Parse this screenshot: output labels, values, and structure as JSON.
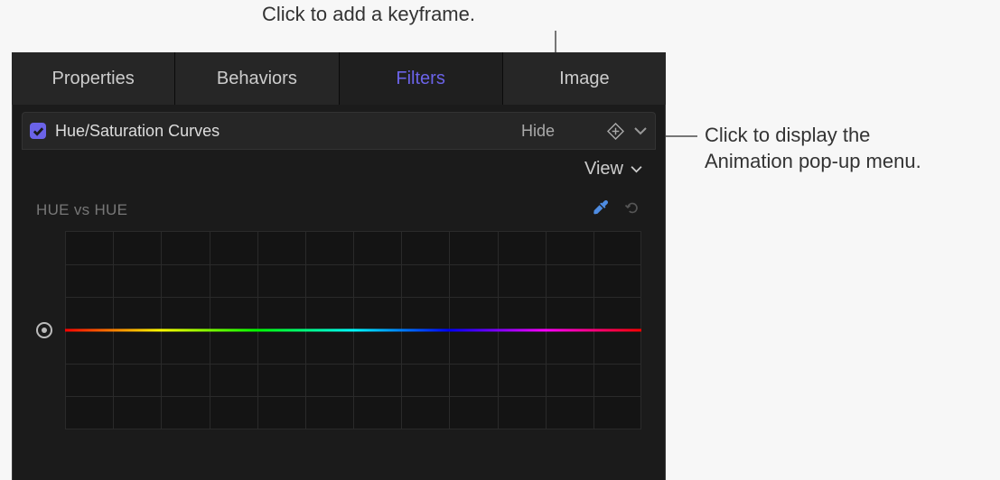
{
  "callouts": {
    "top": "Click to add a keyframe.",
    "right_line1": "Click to display the",
    "right_line2": "Animation pop-up menu."
  },
  "tabs": {
    "properties": "Properties",
    "behaviors": "Behaviors",
    "filters": "Filters",
    "image": "Image"
  },
  "section": {
    "title": "Hue/Saturation Curves",
    "hide": "Hide"
  },
  "view_popup": {
    "label": "View"
  },
  "curve": {
    "label": "HUE vs HUE"
  }
}
